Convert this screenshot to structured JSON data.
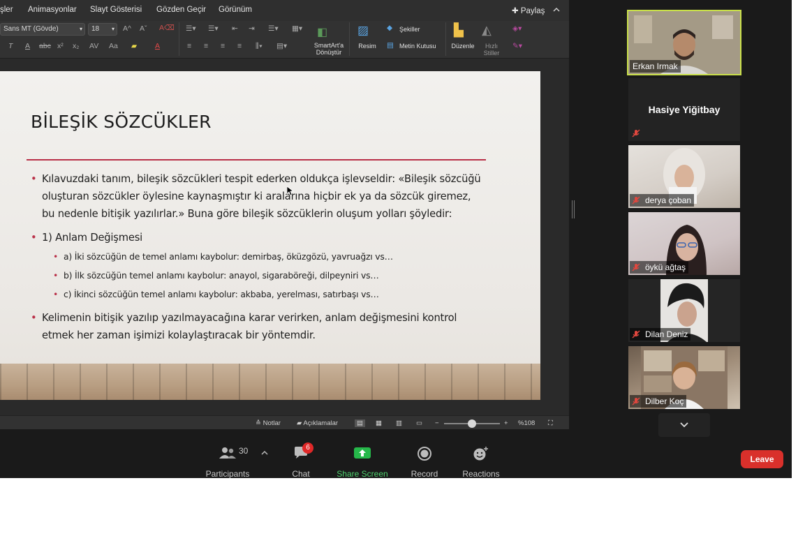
{
  "ppt": {
    "menu": [
      "şler",
      "Animasyonlar",
      "Slayt Gösterisi",
      "Gözden Geçir",
      "Görünüm"
    ],
    "share_label": "Paylaş",
    "ribbon": {
      "font_name": "Sans MT (Gövde)",
      "font_size": "18",
      "smartart_line1": "SmartArt'a",
      "smartart_line2": "Dönüştür",
      "picture": "Resim",
      "shapes": "Şekiller",
      "textbox": "Metin Kutusu",
      "arrange": "Düzenle",
      "quick_styles_line1": "Hızlı",
      "quick_styles_line2": "Stiller"
    },
    "slide": {
      "title": "BİLEŞİK SÖZCÜKLER",
      "bullet1": "Kılavuzdaki tanım, bileşik sözcükleri tespit ederken oldukça işlevseldir: «Bileşik sözcüğü oluşturan sözcükler öylesine kaynaşmıştır ki aralarına hiçbir ek ya da sözcük giremez, bu nedenle bitişik yazılırlar.» Buna göre bileşik sözcüklerin oluşum yolları şöyledir:",
      "bullet2": "1) Anlam Değişmesi",
      "sub_a": "a) İki sözcüğün de temel anlamı kaybolur: demirbaş, öküzgözü, yavruağzı vs…",
      "sub_b": "b) İlk sözcüğün temel anlamı kaybolur: anayol, sigaraböreği, dilpeyniri vs…",
      "sub_c": "c) İkinci sözcüğün temel anlamı kaybolur: akbaba, yerelması, satırbaşı vs…",
      "bullet3": "Kelimenin bitişik yazılıp yazılmayacağına karar verirken, anlam değişmesini kontrol etmek her zaman işimizi kolaylaştıracak bir yöntemdir."
    },
    "status": {
      "notes": "Notlar",
      "comments": "Açıklamalar",
      "zoom": "%108"
    }
  },
  "gallery": [
    {
      "name": "Erkan Irmak"
    },
    {
      "name": "Hasiye Yiğitbay"
    },
    {
      "name": "derya çoban"
    },
    {
      "name": "öykü ağtaş"
    },
    {
      "name": "Dilan Deniz"
    },
    {
      "name": "Dilber Koç"
    }
  ],
  "toolbar": {
    "participants_label": "Participants",
    "participants_count": "30",
    "chat_label": "Chat",
    "chat_badge": "6",
    "share_label": "Share Screen",
    "record_label": "Record",
    "reactions_label": "Reactions",
    "leave_label": "Leave"
  },
  "colors": {
    "accent_red": "#b93048",
    "share_green": "#4fd06e",
    "active_speaker": "#c9e04a",
    "leave": "#d9302b"
  }
}
